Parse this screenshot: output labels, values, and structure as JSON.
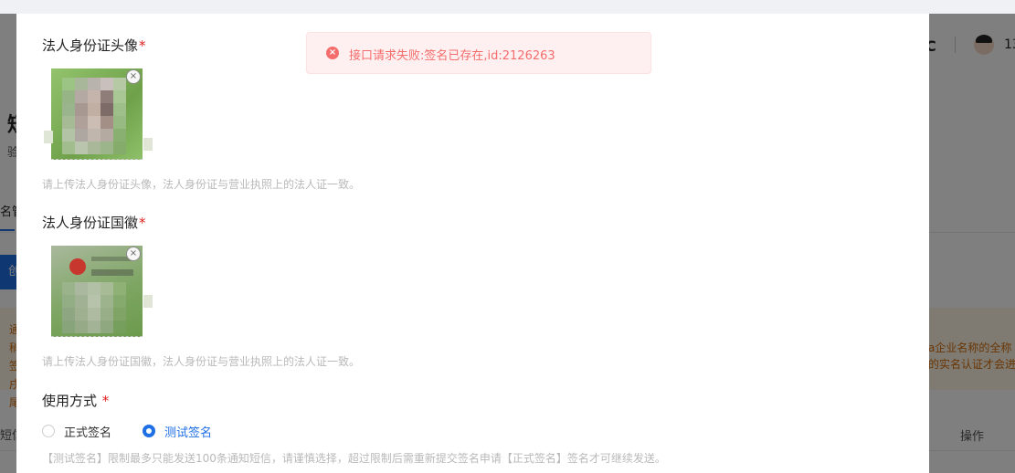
{
  "background": {
    "page_title": "短",
    "page_subtitle": "验",
    "tab_label": "名管",
    "create_button": "创",
    "notice_left": "通稍签戌尾",
    "notice_right_line1": "a企业名称的全称 某",
    "notice_right_line2": "的实名认证才会进",
    "column_left": "短信",
    "column_operation": "操作",
    "topbar_icon": "C",
    "user_label": "13"
  },
  "form": {
    "portrait": {
      "label": "法人身份证头像",
      "required_mark": "*",
      "hint": "请上传法人身份证头像，法人身份证与营业执照上的法人证一致。"
    },
    "emblem": {
      "label": "法人身份证国徽",
      "required_mark": "*",
      "hint": "请上传法人身份证国徽，法人身份证与营业执照上的法人证一致。",
      "card_text": "中华人民共和国 居民身份证"
    },
    "usage": {
      "label": "使用方式",
      "required_mark": "*",
      "options": [
        "正式签名",
        "测试签名"
      ],
      "selected": "测试签名",
      "hint": "【测试签名】限制最多只能发送100条通知短信，请谨慎选择，超过限制后需重新提交签名申请【正式签名】签名才可继续发送。"
    },
    "remove_glyph": "×"
  },
  "toast": {
    "type": "error",
    "icon": "close-circle-icon",
    "icon_glyph": "×",
    "message": "接口请求失败:签名已存在,id:2126263"
  },
  "colors": {
    "accent": "#1f6fe5",
    "error": "#f56c6c",
    "required": "#e02020"
  }
}
